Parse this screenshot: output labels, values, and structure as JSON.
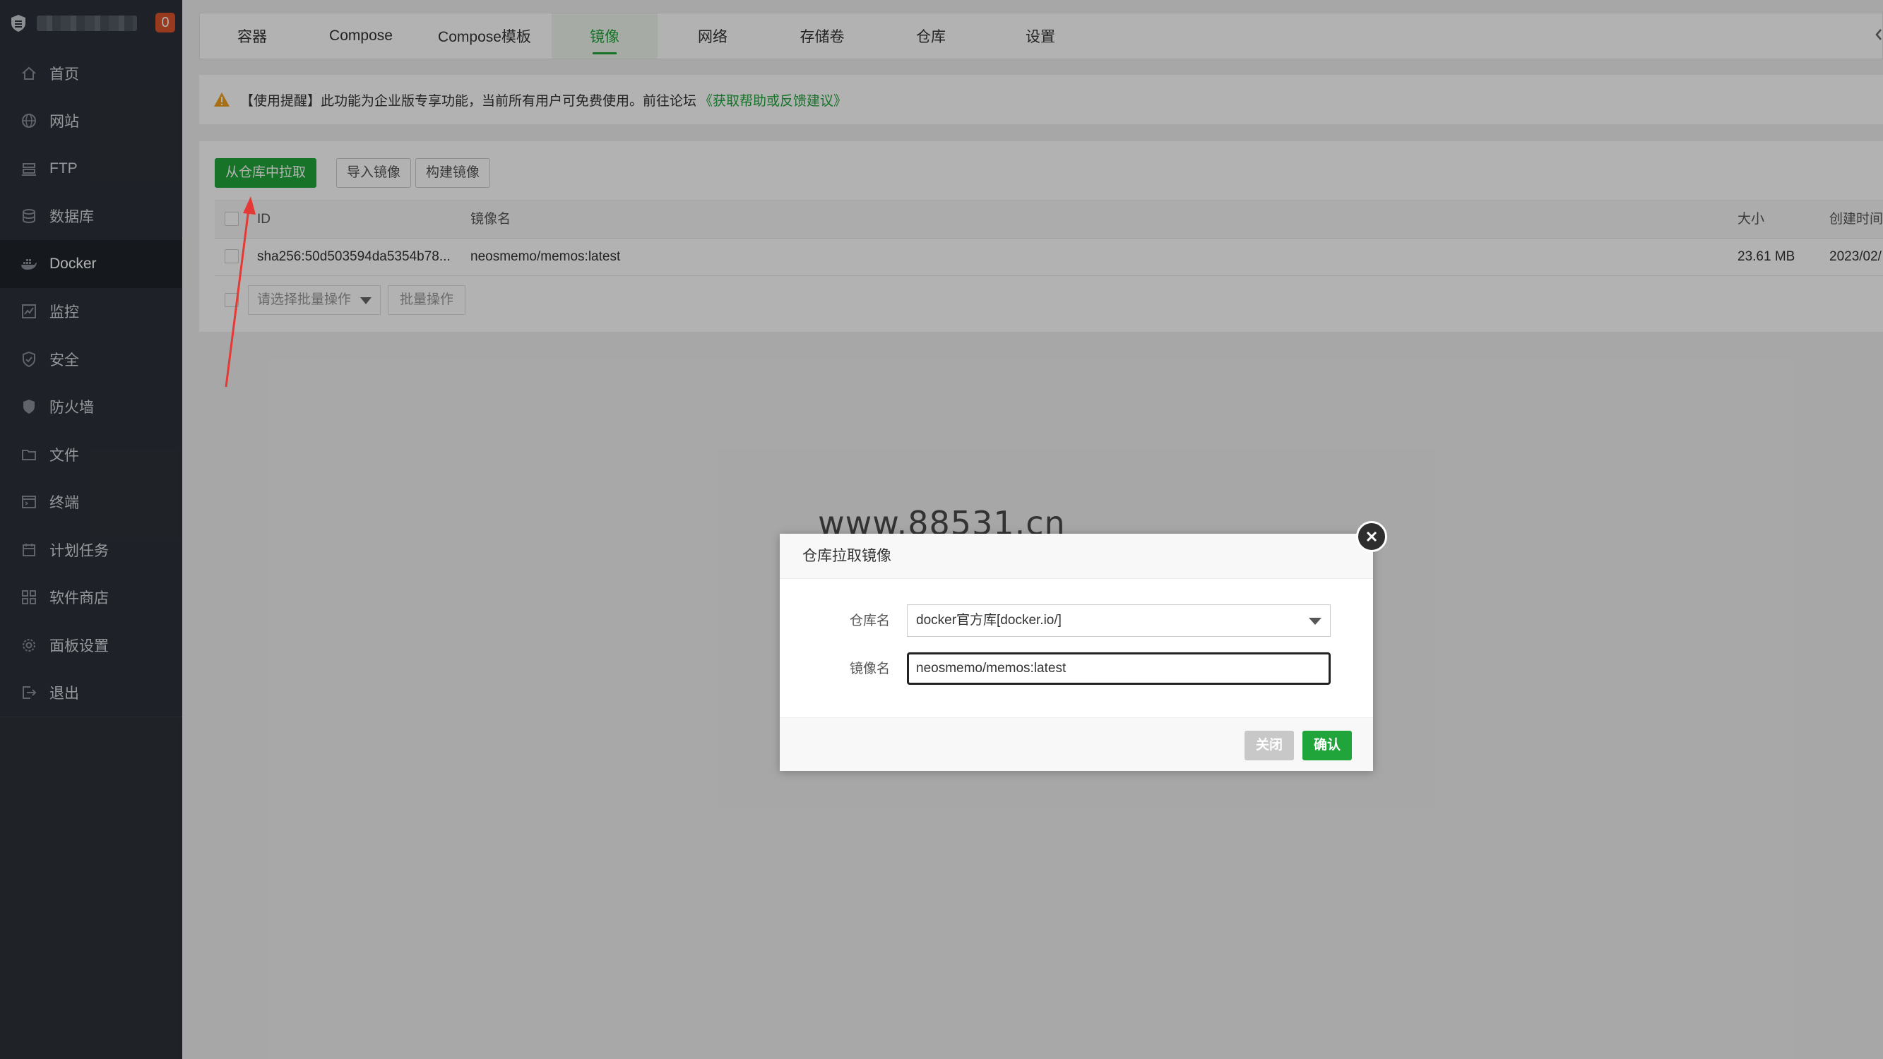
{
  "sidebar": {
    "badge": "0",
    "items": [
      {
        "label": "首页",
        "icon": "home-icon"
      },
      {
        "label": "网站",
        "icon": "globe-icon"
      },
      {
        "label": "FTP",
        "icon": "ftp-icon"
      },
      {
        "label": "数据库",
        "icon": "database-icon"
      },
      {
        "label": "Docker",
        "icon": "docker-icon",
        "active": true
      },
      {
        "label": "监控",
        "icon": "monitor-icon"
      },
      {
        "label": "安全",
        "icon": "shield-icon"
      },
      {
        "label": "防火墙",
        "icon": "firewall-icon"
      },
      {
        "label": "文件",
        "icon": "folder-icon"
      },
      {
        "label": "终端",
        "icon": "terminal-icon"
      },
      {
        "label": "计划任务",
        "icon": "calendar-icon"
      },
      {
        "label": "软件商店",
        "icon": "grid-icon"
      },
      {
        "label": "面板设置",
        "icon": "gear-icon"
      },
      {
        "label": "退出",
        "icon": "logout-icon"
      }
    ]
  },
  "tabs": [
    {
      "label": "容器"
    },
    {
      "label": "Compose"
    },
    {
      "label": "Compose模板"
    },
    {
      "label": "镜像",
      "active": true
    },
    {
      "label": "网络"
    },
    {
      "label": "存储卷"
    },
    {
      "label": "仓库"
    },
    {
      "label": "设置"
    }
  ],
  "notice": {
    "text": "【使用提醒】此功能为企业版专享功能，当前所有用户可免费使用。前往论坛",
    "link": "《获取帮助或反馈建议》"
  },
  "toolbar": {
    "pull_label": "从仓库中拉取",
    "import_label": "导入镜像",
    "build_label": "构建镜像"
  },
  "table": {
    "headers": {
      "id": "ID",
      "name": "镜像名",
      "size": "大小",
      "created": "创建时间"
    },
    "rows": [
      {
        "id": "sha256:50d503594da5354b78...",
        "name": "neosmemo/memos:latest",
        "size": "23.61 MB",
        "created": "2023/02/"
      }
    ],
    "batch_placeholder": "请选择批量操作",
    "batch_button": "批量操作"
  },
  "watermark": "www.88531.cn",
  "dialog": {
    "title": "仓库拉取镜像",
    "repo_label": "仓库名",
    "repo_value": "docker官方库[docker.io/]",
    "image_label": "镜像名",
    "image_value": "neosmemo/memos:latest",
    "close_label": "关闭",
    "confirm_label": "确认"
  },
  "colors": {
    "accent": "#20a53a",
    "sidebar": "#2c323a",
    "badge": "#d9532b",
    "annotation_arrow": "#e53935"
  }
}
